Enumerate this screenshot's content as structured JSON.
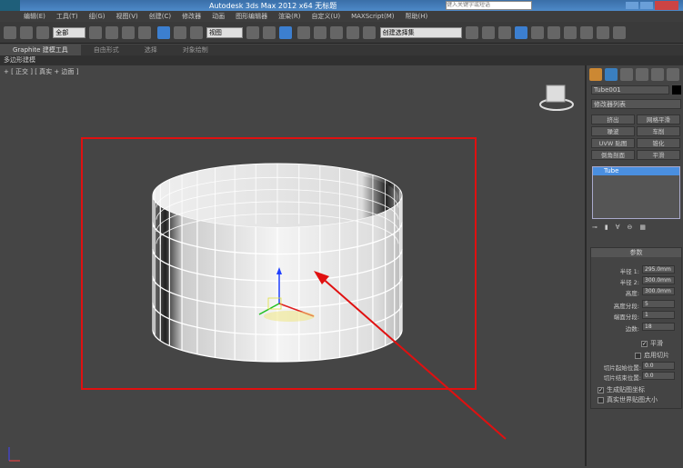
{
  "title": "Autodesk 3ds Max  2012 x64     无标题",
  "search_placeholder": "键入关键字或短语",
  "menu": [
    "编辑(E)",
    "工具(T)",
    "组(G)",
    "视图(V)",
    "创建(C)",
    "修改器",
    "动画",
    "图形编辑器",
    "渲染(R)",
    "自定义(U)",
    "MAXScript(M)",
    "帮助(H)"
  ],
  "toolbar": {
    "selection_filter": "全部",
    "ref_coord": "视图",
    "named_selection": "创建选择集"
  },
  "ribbon": {
    "tabs": [
      "Graphite 建模工具",
      "自由形式",
      "选择",
      "对象绘制"
    ],
    "sub": "多边形建模"
  },
  "viewport": {
    "label": "+ [ 正交 ] [ 真实 + 边面 ]",
    "highlight_color": "#e01010"
  },
  "panel": {
    "object_name": "Tube001",
    "modifier_list": "修改器列表",
    "modifiers": [
      "挤出",
      "网格平滑",
      "噪波",
      "车削",
      "UVW 贴图",
      "锥化",
      "倒角剖面",
      "平滑"
    ],
    "stack": [
      "Tube"
    ],
    "rollout": "参数",
    "params": [
      {
        "label": "半径 1:",
        "value": "295.0mm"
      },
      {
        "label": "半径 2:",
        "value": "300.0mm"
      },
      {
        "label": "高度:",
        "value": "300.0mm"
      },
      {
        "label": "高度分段:",
        "value": "5"
      },
      {
        "label": "端面分段:",
        "value": "1"
      },
      {
        "label": "边数:",
        "value": "18"
      }
    ],
    "smooth": {
      "label": "平滑",
      "checked": true
    },
    "slice_on": {
      "label": "启用切片",
      "checked": false
    },
    "slice_from": {
      "label": "切片起始位置:",
      "value": "0.0"
    },
    "slice_to": {
      "label": "切片结束位置:",
      "value": "0.0"
    },
    "gen_map": {
      "label": "生成贴图坐标",
      "checked": true
    },
    "real_world": {
      "label": "真实世界贴图大小",
      "checked": false
    }
  }
}
